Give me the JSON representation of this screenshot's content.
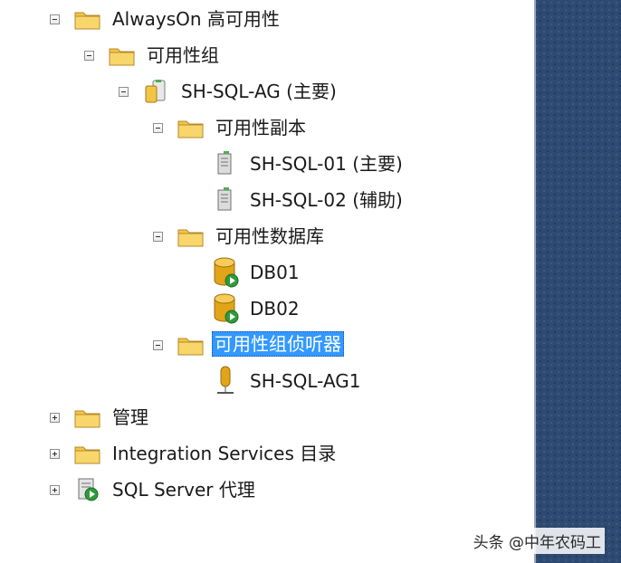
{
  "tree": {
    "alwayson": {
      "label": "AlwaysOn 高可用性"
    },
    "ag_group": {
      "label": "可用性组"
    },
    "ag": {
      "label": "SH-SQL-AG (主要)"
    },
    "replicas": {
      "label": "可用性副本"
    },
    "replica1": {
      "label": "SH-SQL-01 (主要)"
    },
    "replica2": {
      "label": "SH-SQL-02 (辅助)"
    },
    "databases": {
      "label": "可用性数据库"
    },
    "db1": {
      "label": "DB01"
    },
    "db2": {
      "label": "DB02"
    },
    "listeners": {
      "label": "可用性组侦听器"
    },
    "listener": {
      "label": "SH-SQL-AG1"
    },
    "management": {
      "label": "管理"
    },
    "integration": {
      "label": "Integration Services 目录"
    },
    "agent": {
      "label": "SQL Server 代理"
    }
  },
  "watermark": "头条 @中年农码工",
  "colors": {
    "selection": "#3399ff",
    "folder": "#f3c545",
    "database": "#e2a418",
    "side_panel": "#2e4a72"
  }
}
